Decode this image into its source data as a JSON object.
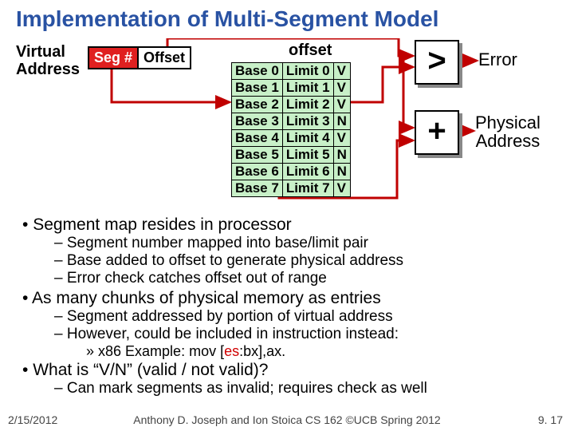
{
  "title": "Implementation of Multi-Segment Model",
  "va_label_1": "Virtual",
  "va_label_2": "Address",
  "seg_label": "Seg #",
  "offset_label": "Offset",
  "offset_top": "offset",
  "gt": ">",
  "plus": "+",
  "error": "Error",
  "phys1": "Physical",
  "phys2": "Address",
  "table": [
    {
      "b": "Base 0",
      "l": "Limit 0",
      "v": "V"
    },
    {
      "b": "Base 1",
      "l": "Limit 1",
      "v": "V"
    },
    {
      "b": "Base 2",
      "l": "Limit 2",
      "v": "V"
    },
    {
      "b": "Base 3",
      "l": "Limit 3",
      "v": "N"
    },
    {
      "b": "Base 4",
      "l": "Limit 4",
      "v": "V"
    },
    {
      "b": "Base 5",
      "l": "Limit 5",
      "v": "N"
    },
    {
      "b": "Base 6",
      "l": "Limit 6",
      "v": "N"
    },
    {
      "b": "Base 7",
      "l": "Limit 7",
      "v": "V"
    }
  ],
  "bul": {
    "b1": "Segment map resides in processor",
    "b1a": "Segment number mapped into base/limit pair",
    "b1b": "Base added to offset to generate physical address",
    "b1c": "Error check catches offset out of range",
    "b2": "As many chunks of physical memory as entries",
    "b2a": "Segment addressed by portion of virtual address",
    "b2b": "However, could be included in instruction instead:",
    "b2c_pre": "x86 Example: mov [",
    "b2c_es": "es",
    "b2c_post": ":bx],ax.",
    "b3": "What is “V/N” (valid / not valid)?",
    "b3a": "Can mark segments as invalid; requires check as well"
  },
  "footer": {
    "date": "2/15/2012",
    "mid": "Anthony D. Joseph and Ion Stoica CS 162 ©UCB Spring 2012",
    "num": "9. 17"
  }
}
